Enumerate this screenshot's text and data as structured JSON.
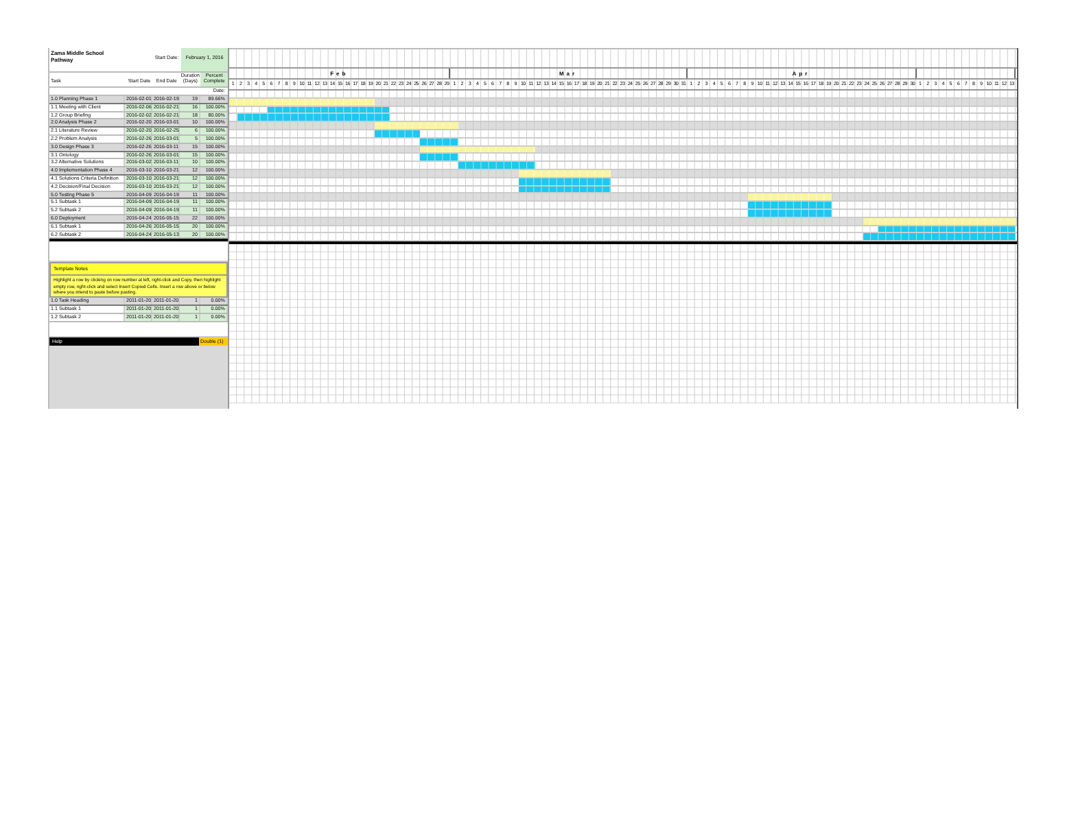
{
  "project": {
    "title": "Zama Middle School Pathway",
    "start_label": "Start Date:",
    "start_date": "February 1, 2016"
  },
  "columns": [
    "Task",
    "Start Date",
    "End Date",
    "Duration (Days)",
    "Percent Complete"
  ],
  "date_label": "Date:",
  "months": [
    {
      "label": "Feb",
      "days": [
        "1",
        "2",
        "3",
        "4",
        "5",
        "6",
        "7",
        "8",
        "9",
        "10",
        "11",
        "12",
        "13",
        "14",
        "15",
        "16",
        "17",
        "18",
        "19",
        "20",
        "21",
        "22",
        "23",
        "24",
        "25",
        "26",
        "27",
        "28",
        "29"
      ]
    },
    {
      "label": "Mar",
      "days": [
        "1",
        "2",
        "3",
        "4",
        "5",
        "6",
        "7",
        "8",
        "9",
        "10",
        "11",
        "12",
        "13",
        "14",
        "15",
        "16",
        "17",
        "18",
        "19",
        "20",
        "21",
        "22",
        "23",
        "24",
        "25",
        "26",
        "27",
        "28",
        "29",
        "30",
        "31"
      ]
    },
    {
      "label": "Apr",
      "days": [
        "1",
        "2",
        "3",
        "4",
        "5",
        "6",
        "7",
        "8",
        "9",
        "10",
        "11",
        "12",
        "13",
        "14",
        "15",
        "16",
        "17",
        "18",
        "19",
        "20",
        "21",
        "22",
        "23",
        "24",
        "25",
        "26",
        "27",
        "28",
        "29",
        "30"
      ]
    },
    {
      "days": [
        "1",
        "2",
        "3",
        "4",
        "5",
        "6",
        "7",
        "8",
        "9",
        "10",
        "11",
        "12",
        "13"
      ]
    }
  ],
  "tasks": [
    {
      "kind": "phase",
      "task": "1.0 Planning Phase 1",
      "start": "2016-02-01",
      "end": "2016-02-19",
      "duration": "19",
      "percent": "89.66%"
    },
    {
      "kind": "task",
      "task": "1.1 Meeting with Client",
      "start": "2016-02-06",
      "end": "2016-02-21",
      "duration": "16",
      "percent": "100.00%"
    },
    {
      "kind": "task",
      "task": "1.2 Group Briefing",
      "start": "2016-02-02",
      "end": "2016-02-21",
      "duration": "18",
      "percent": "80.00%"
    },
    {
      "kind": "phase",
      "task": "2.0 Analysis Phase 2",
      "start": "2016-02-20",
      "end": "2016-03-01",
      "duration": "10",
      "percent": "100.00%"
    },
    {
      "kind": "task",
      "task": "2.1 Literature Review",
      "start": "2016-02-20",
      "end": "2016-02-25",
      "duration": "6",
      "percent": "100.00%"
    },
    {
      "kind": "task",
      "task": "2.2 Problem Analysis",
      "start": "2016-02-26",
      "end": "2016-03-01",
      "duration": "5",
      "percent": "100.00%"
    },
    {
      "kind": "phase",
      "task": "3.0 Design Phase 3",
      "start": "2016-02-26",
      "end": "2016-03-11",
      "duration": "15",
      "percent": "100.00%"
    },
    {
      "kind": "task",
      "task": "3.1 Ontology",
      "start": "2016-02-26",
      "end": "2016-03-01",
      "duration": "15",
      "percent": "100.00%"
    },
    {
      "kind": "task",
      "task": "3.2 Alternative Solutions",
      "start": "2016-03-02",
      "end": "2016-03-11",
      "duration": "10",
      "percent": "100.00%"
    },
    {
      "kind": "phase",
      "task": "4.0 Implementation Phase 4",
      "start": "2016-03-10",
      "end": "2016-03-21",
      "duration": "12",
      "percent": "100.00%"
    },
    {
      "kind": "task",
      "task": "4.1 Solutions Criteria Definition",
      "start": "2016-03-10",
      "end": "2016-03-21",
      "duration": "12",
      "percent": "100.00%"
    },
    {
      "kind": "task",
      "task": "4.2 Decision/Final Decision",
      "start": "2016-03-10",
      "end": "2016-03-21",
      "duration": "12",
      "percent": "100.00%"
    },
    {
      "kind": "phase",
      "task": "5.0 Testing Phase 5",
      "start": "2016-04-09",
      "end": "2016-04-19",
      "duration": "11",
      "percent": "100.00%"
    },
    {
      "kind": "task",
      "task": "5.1 Subtask 1",
      "start": "2016-04-09",
      "end": "2016-04-19",
      "duration": "11",
      "percent": "100.00%"
    },
    {
      "kind": "task",
      "task": "5.2 Subtask 2",
      "start": "2016-04-09",
      "end": "2016-04-19",
      "duration": "11",
      "percent": "100.00%"
    },
    {
      "kind": "phase",
      "task": "6.0 Deployment",
      "start": "2016-04-24",
      "end": "2016-05-15",
      "duration": "22",
      "percent": "100.00%"
    },
    {
      "kind": "task",
      "task": "6.1 Subtask 1",
      "start": "2016-04-26",
      "end": "2016-05-15",
      "duration": "20",
      "percent": "100.00%"
    },
    {
      "kind": "task",
      "task": "6.2 Subtask 2",
      "start": "2016-04-24",
      "end": "2016-05-13",
      "duration": "20",
      "percent": "100.00%"
    }
  ],
  "notes": {
    "title": "Template Notes",
    "text": "Highlight a row by clicking on row number at left, right-click and Copy, then highlight empty row, right-click and select Insert Copied Cells. Insert a row above or below where you intend to paste before pasting."
  },
  "template_tasks": [
    {
      "kind": "phase",
      "task": "1.0 Task Heading",
      "start": "2011-01-20",
      "end": "2011-01-20",
      "duration": "1",
      "percent": "0.00%"
    },
    {
      "kind": "task",
      "task": "1.1 Subtask 1",
      "start": "2011-01-20",
      "end": "2011-01-20",
      "duration": "1",
      "percent": "0.00%"
    },
    {
      "kind": "task",
      "task": "1.2 Subtask 2",
      "start": "2011-01-20",
      "end": "2011-01-20",
      "duration": "1",
      "percent": "0.00%"
    }
  ],
  "help": {
    "label": "Help",
    "value": "Double (1)"
  }
}
